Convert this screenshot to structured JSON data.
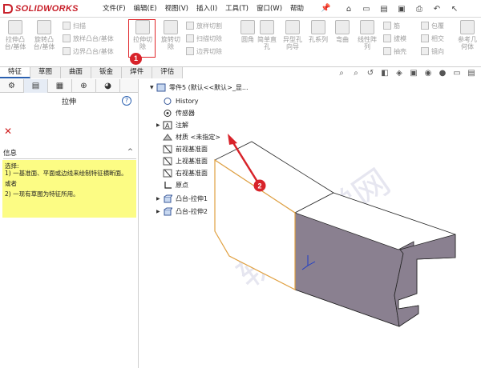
{
  "app": {
    "logo_text": "SOLIDWORKS",
    "menu": [
      "文件(F)",
      "编辑(E)",
      "视图(V)",
      "插入(I)",
      "工具(T)",
      "窗口(W)",
      "帮助"
    ]
  },
  "ribbon": {
    "big_buttons": [
      {
        "label": "拉伸凸\n台/基体"
      },
      {
        "label": "旋转凸\n台/基体"
      },
      {
        "label": "拉伸切\n除"
      },
      {
        "label": "旋转切\n除"
      },
      {
        "label": "圆角"
      },
      {
        "label": "简单直\n孔"
      },
      {
        "label": "异型孔\n向导"
      },
      {
        "label": "孔系列"
      },
      {
        "label": "弯曲"
      },
      {
        "label": "线性阵\n列"
      },
      {
        "label": "参考几\n何体"
      }
    ],
    "small_buttons": [
      "扫描",
      "放样凸台/基体",
      "边界凸台/基体",
      "放样切割",
      "扫描切除",
      "边界切除",
      "筋",
      "包覆",
      "拔模",
      "相交",
      "抽壳",
      "镜向"
    ]
  },
  "tabs": [
    "特征",
    "草图",
    "曲面",
    "钣金",
    "焊件",
    "评估"
  ],
  "property_manager": {
    "title": "拉伸",
    "info_header": "信息",
    "info_lines": [
      "选择:",
      "1) 一基准面、平面或边线来绘制特征横断面。",
      "或者",
      "2) 一现有草图为特征所用。"
    ]
  },
  "tree": {
    "root": "零件5 (默认<<默认>_显...",
    "items": [
      "History",
      "传感器",
      "注解",
      "材质 <未指定>",
      "前视基准面",
      "上视基准面",
      "右视基准面",
      "原点",
      "凸台-拉伸1",
      "凸台-拉伸2"
    ]
  },
  "badges": {
    "one": "1",
    "two": "2"
  },
  "colors": {
    "accent_red": "#d8232a",
    "info_yellow": "#fcfc84",
    "face_gray": "#8a8090",
    "edge_orange": "#e0a040"
  }
}
